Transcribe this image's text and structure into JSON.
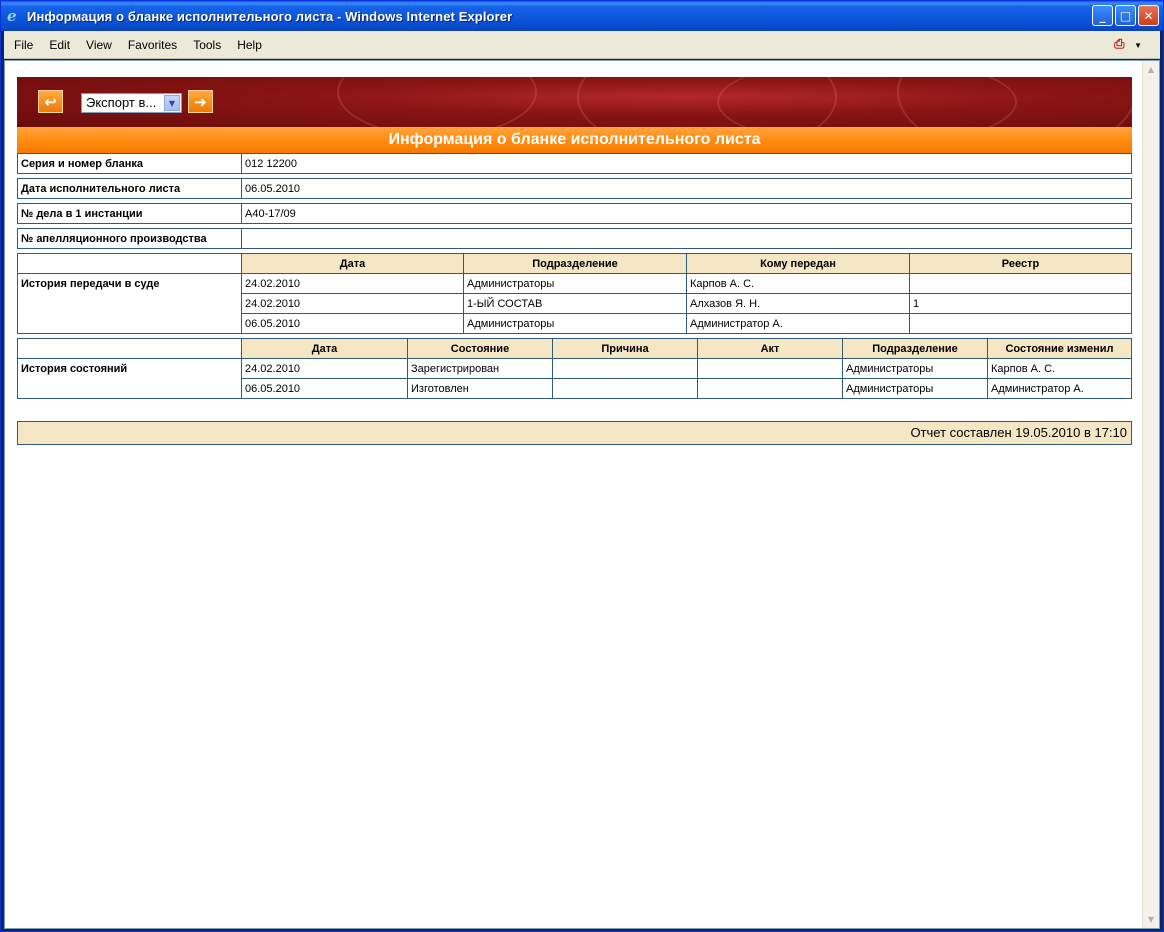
{
  "window": {
    "title": "Информация о бланке исполнительного листа - Windows Internet Explorer",
    "buttons": {
      "minimize": "_",
      "maximize": "□",
      "close": "✕"
    }
  },
  "menu": {
    "items": [
      "File",
      "Edit",
      "View",
      "Favorites",
      "Tools",
      "Help"
    ]
  },
  "toolbar": {
    "export_value": "Экспорт в..."
  },
  "page": {
    "heading": "Информация о бланке исполнительного листа",
    "fields": [
      {
        "label": "Серия и номер бланка",
        "value": "012 12200"
      },
      {
        "label": "Дата исполнительного листа",
        "value": "06.05.2010"
      },
      {
        "label": "№ дела в 1 инстанции",
        "value": "А40-17/09"
      },
      {
        "label": "№ апелляционного производства",
        "value": ""
      }
    ],
    "transfer_history": {
      "label": "История передачи в суде",
      "columns": [
        "Дата",
        "Подразделение",
        "Кому передан",
        "Реестр"
      ],
      "rows": [
        [
          "24.02.2010",
          "Администраторы",
          "Карпов А. С.",
          ""
        ],
        [
          "24.02.2010",
          "1-ЫЙ СОСТАВ",
          "Алхазов Я. Н.",
          "1"
        ],
        [
          "06.05.2010",
          "Администраторы",
          "Администратор А.",
          ""
        ]
      ]
    },
    "state_history": {
      "label": "История состояний",
      "columns": [
        "Дата",
        "Состояние",
        "Причина",
        "Акт",
        "Подразделение",
        "Состояние изменил"
      ],
      "rows": [
        [
          "24.02.2010",
          "Зарегистрирован",
          "",
          "",
          "Администраторы",
          "Карпов А. С."
        ],
        [
          "06.05.2010",
          "Изготовлен",
          "",
          "",
          "Администраторы",
          "Администратор А."
        ]
      ]
    },
    "footer": "Отчет составлен 19.05.2010 в 17:10"
  }
}
